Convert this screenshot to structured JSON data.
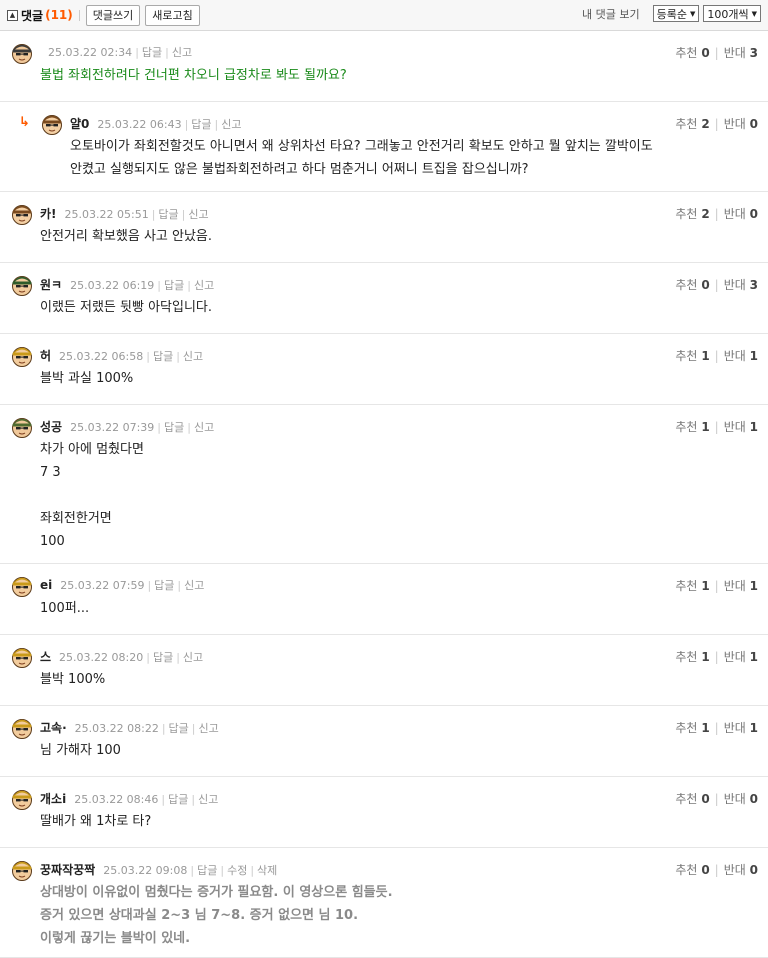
{
  "toolbar": {
    "title": "댓글",
    "count": "(11)",
    "write_label": "댓글쓰기",
    "refresh_label": "새로고침",
    "my_comments_label": "내 댓글 보기",
    "sort_value": "등록순",
    "per_page_value": "100개씩"
  },
  "labels": {
    "reply": "답글",
    "report": "신고",
    "edit": "수정",
    "delete": "삭제",
    "recommend": "추천",
    "oppose": "반대"
  },
  "comments": [
    {
      "nick": "",
      "date": "25.03.22 02:34",
      "up": "0",
      "down": "3",
      "lines": [
        "불법 좌회전하려다 건너편 차오니 급정차로 봐도 될까요?"
      ]
    },
    {
      "nick": "얄0",
      "date": "25.03.22 06:43",
      "up": "2",
      "down": "0",
      "lines": [
        "오토바이가 좌회전할것도 아니면서 왜 상위차선 타요? 그래놓고 안전거리 확보도 안하고 뭘 앞치는 깔박이도",
        "안켰고 실행되지도 않은 불법좌회전하려고 하다 멈춘거니 어쩌니 트집을 잡으십니까?"
      ]
    },
    {
      "nick": "카!",
      "date": "25.03.22 05:51",
      "up": "2",
      "down": "0",
      "lines": [
        "안전거리 확보했음 사고 안났음."
      ]
    },
    {
      "nick": "원ㅋ",
      "date": "25.03.22 06:19",
      "up": "0",
      "down": "3",
      "lines": [
        "이랬든 저랬든 뒷빵 아닥입니다."
      ]
    },
    {
      "nick": "허",
      "date": "25.03.22 06:58",
      "up": "1",
      "down": "1",
      "lines": [
        "블박 과실 100%"
      ]
    },
    {
      "nick": "성공",
      "date": "25.03.22 07:39",
      "up": "1",
      "down": "1",
      "lines": [
        "차가 아에 멈췄다면",
        "7 3",
        "",
        "좌회전한거면",
        "100"
      ]
    },
    {
      "nick": "ei",
      "date": "25.03.22 07:59",
      "up": "1",
      "down": "1",
      "lines": [
        "100퍼..."
      ]
    },
    {
      "nick": "스",
      "date": "25.03.22 08:20",
      "up": "1",
      "down": "1",
      "lines": [
        "블박 100%"
      ]
    },
    {
      "nick": "고속·",
      "date": "25.03.22 08:22",
      "up": "1",
      "down": "1",
      "lines": [
        "님 가해자 100"
      ]
    },
    {
      "nick": "개소i",
      "date": "25.03.22 08:46",
      "up": "0",
      "down": "0",
      "lines": [
        "딸배가 왜 1차로 타?"
      ]
    },
    {
      "nick": "꿍짜작꿍짝",
      "date": "25.03.22 09:08",
      "up": "0",
      "down": "0",
      "lines": [
        "상대방이 이유없이 멈췄다는 증거가 필요함. 이 영상으론 힘들듯.",
        "증거 있으면 상대과실 2~3 님 7~8. 증거 없으면 님 10.",
        "이렇게 끊기는 블박이 있네."
      ]
    }
  ]
}
